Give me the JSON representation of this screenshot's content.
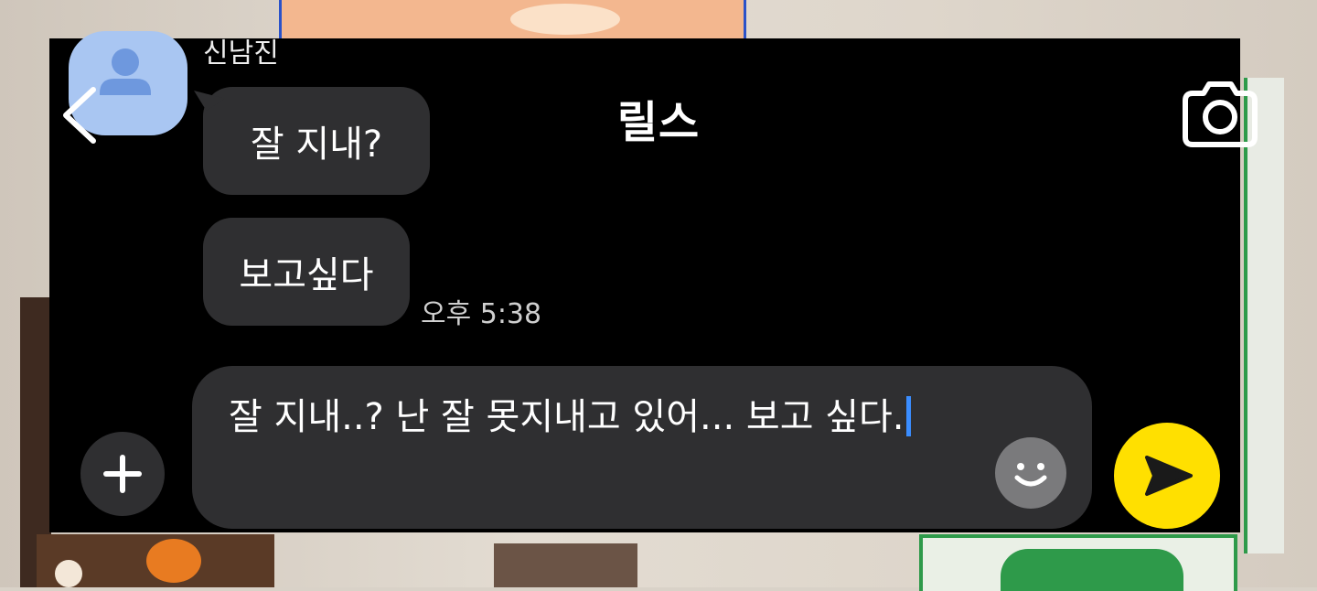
{
  "header": {
    "title": "릴스",
    "back_icon": "chevron-left-icon",
    "camera_icon": "camera-icon"
  },
  "messages": [
    {
      "sender": "신남진",
      "text": "잘 지내?"
    },
    {
      "text": "보고싶다",
      "time": "오후 5:38"
    }
  ],
  "composer": {
    "value": "잘 지내..? 난 잘 못지내고 있어... 보고 싶다.",
    "plus_icon": "plus-icon",
    "emoji_icon": "smiley-icon",
    "send_icon": "send-icon"
  },
  "colors": {
    "accent": "#ffe000",
    "bubble": "#2f2f31",
    "avatar": "#a9c6f2"
  }
}
